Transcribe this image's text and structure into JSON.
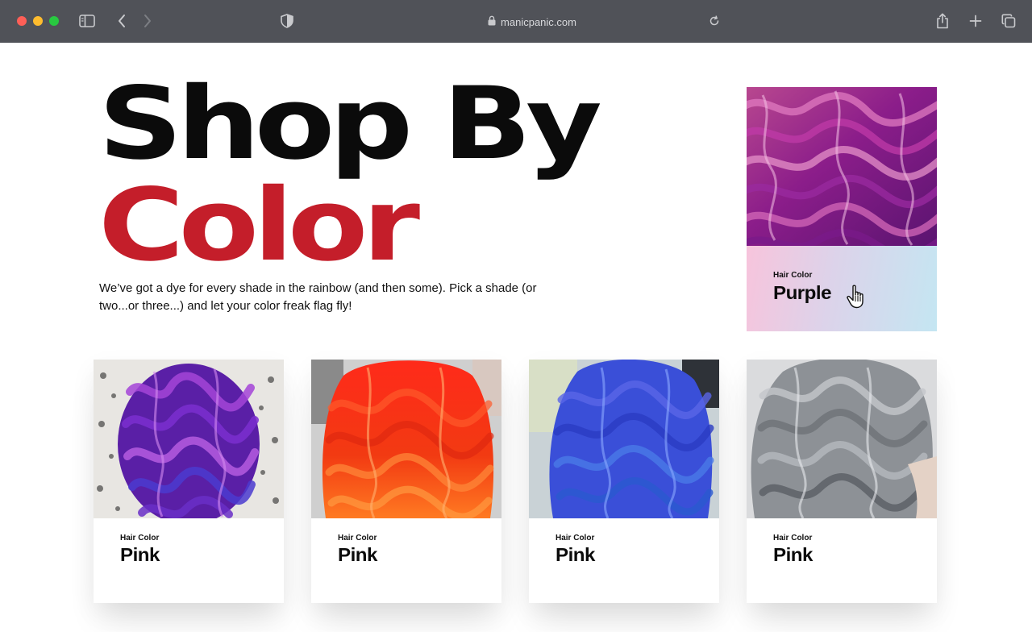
{
  "browser": {
    "url": "manicpanic.com",
    "icons": [
      "sidebar-icon",
      "back-icon",
      "forward-icon",
      "shield-icon",
      "lock-icon",
      "reload-icon",
      "share-icon",
      "new-tab-icon",
      "tabs-icon"
    ]
  },
  "hero": {
    "title_line1": "Shop By",
    "title_line2": "Color",
    "intro": "We’ve got a dye for every shade in the rainbow (and then some). Pick a shade (or two...or three...) and let your color freak flag fly!"
  },
  "featured_card": {
    "kicker": "Hair Color",
    "name": "Purple"
  },
  "cards": [
    {
      "kicker": "Hair Color",
      "name": "Pink"
    },
    {
      "kicker": "Hair Color",
      "name": "Pink"
    },
    {
      "kicker": "Hair Color",
      "name": "Pink"
    },
    {
      "kicker": "Hair Color",
      "name": "Pink"
    }
  ],
  "colors": {
    "title_dark": "#0b0b0b",
    "title_accent": "#c41e2a",
    "chrome": "#505258"
  }
}
